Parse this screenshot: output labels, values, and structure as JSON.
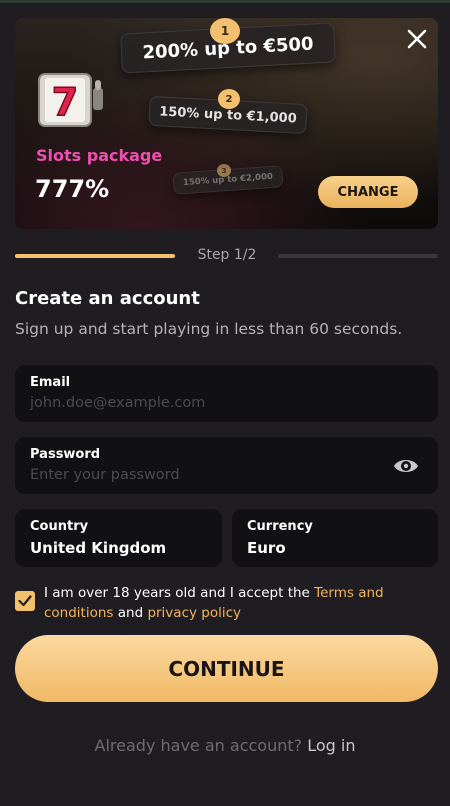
{
  "banner": {
    "offers": [
      {
        "number": "1",
        "text": "200% up to €500"
      },
      {
        "number": "2",
        "text": "150% up to €1,000"
      },
      {
        "number": "3",
        "text": "150% up to €2,000"
      }
    ],
    "package_title": "Slots package",
    "package_percent": "777%",
    "change_label": "CHANGE",
    "close_icon": "close-icon",
    "slot_icon": "slot-machine-icon"
  },
  "step": {
    "label": "Step 1/2",
    "progress": 0.5
  },
  "form": {
    "title": "Create an account",
    "subtitle": "Sign up and start playing in less than 60 seconds.",
    "email": {
      "label": "Email",
      "placeholder": "john.doe@example.com",
      "value": ""
    },
    "password": {
      "label": "Password",
      "placeholder": "Enter your password",
      "value": ""
    },
    "country": {
      "label": "Country",
      "value": "United Kingdom"
    },
    "currency": {
      "label": "Currency",
      "value": "Euro"
    },
    "terms": {
      "checked": true,
      "text_before": "I am over 18 years old and I accept the ",
      "terms_link": "Terms and conditions",
      "text_middle": " and ",
      "privacy_link": "privacy policy"
    },
    "continue_label": "CONTINUE",
    "login_prompt": "Already have an account?",
    "login_link": "Log in"
  },
  "colors": {
    "accent": "#f2c06e",
    "pink": "#f04fb0",
    "link": "#f2b35a",
    "background": "#1f1d21",
    "field": "#111012"
  }
}
